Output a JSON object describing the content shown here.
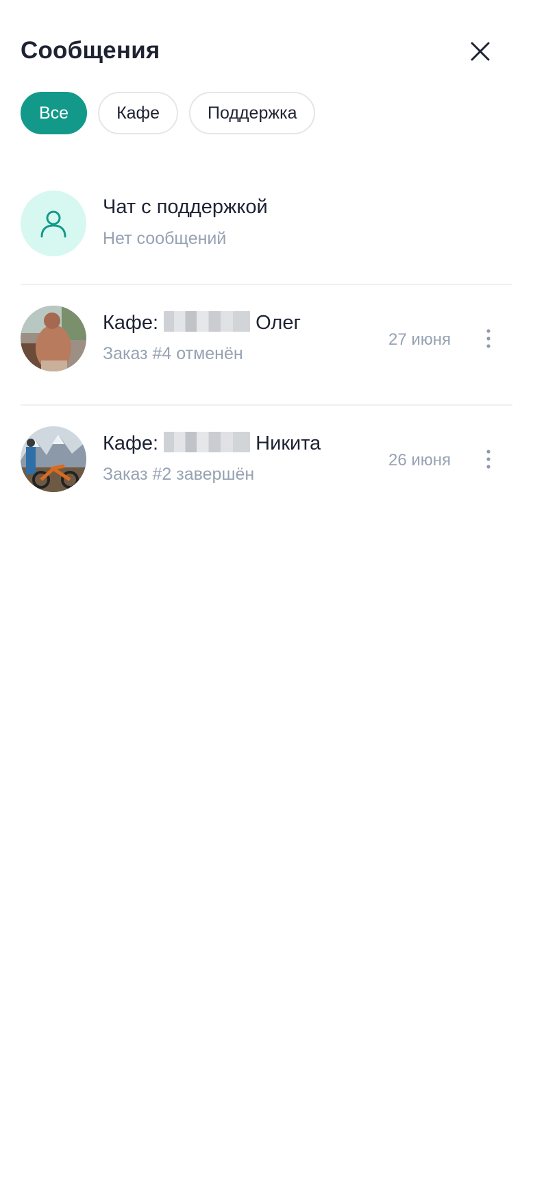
{
  "header": {
    "title": "Сообщения"
  },
  "filters": [
    {
      "label": "Все",
      "active": true
    },
    {
      "label": "Кафе",
      "active": false
    },
    {
      "label": "Поддержка",
      "active": false
    }
  ],
  "chats": [
    {
      "title": "Чат с поддержкой",
      "subtitle": "Нет сообщений",
      "date": "",
      "avatar": "support-user-icon"
    },
    {
      "title_prefix": "Кафе: ",
      "title_suffix": " Олег",
      "subtitle": "Заказ #4 отменён",
      "date": "27 июня",
      "avatar": "user-photo"
    },
    {
      "title_prefix": "Кафе: ",
      "title_suffix": " Никита",
      "subtitle": "Заказ #2 завершён",
      "date": "26 июня",
      "avatar": "user-photo"
    }
  ],
  "colors": {
    "accent": "#13998a",
    "support_avatar_bg": "#d7f8f1",
    "muted_text": "#97a2b3"
  },
  "icons": {
    "close": "close-icon",
    "more": "more-vertical-icon"
  }
}
